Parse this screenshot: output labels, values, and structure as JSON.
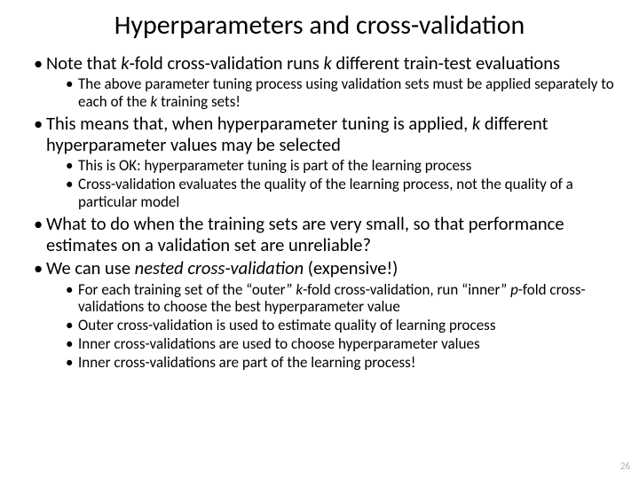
{
  "title": "Hyperparameters and cross-validation",
  "b1": {
    "pre": "Note that ",
    "k1": "k",
    "mid": "-fold cross-validation runs ",
    "k2": "k",
    "post": " different train-test evaluations"
  },
  "b1s1": {
    "pre": "The above parameter tuning process using validation sets must be applied separately to each of the ",
    "k": "k",
    "post": " training sets!"
  },
  "b2": {
    "pre": "This means that, when hyperparameter tuning is applied, ",
    "k": "k",
    "post": " different hyperparameter values may be selected"
  },
  "b2s1": "This is OK: hyperparameter tuning is part of the learning process",
  "b2s2": "Cross-validation evaluates the quality of the learning process, not the quality of a particular model",
  "b3": "What to do when the training sets are very small, so that performance estimates on a validation set are unreliable?",
  "b4": {
    "pre": "We can use ",
    "em": "nested cross-validation",
    "post": " (expensive!)"
  },
  "b4s1": {
    "pre": "For each training set of the “outer” ",
    "k": "k",
    "mid": "-fold cross-validation, run “inner” ",
    "p": "p",
    "post": "-fold cross-validations to choose the best hyperparameter value"
  },
  "b4s2": "Outer cross-validation is used to estimate quality of learning process",
  "b4s3": "Inner cross-validations are used to choose hyperparameter values",
  "b4s4": "Inner cross-validations are part of the learning process!",
  "page": "26"
}
